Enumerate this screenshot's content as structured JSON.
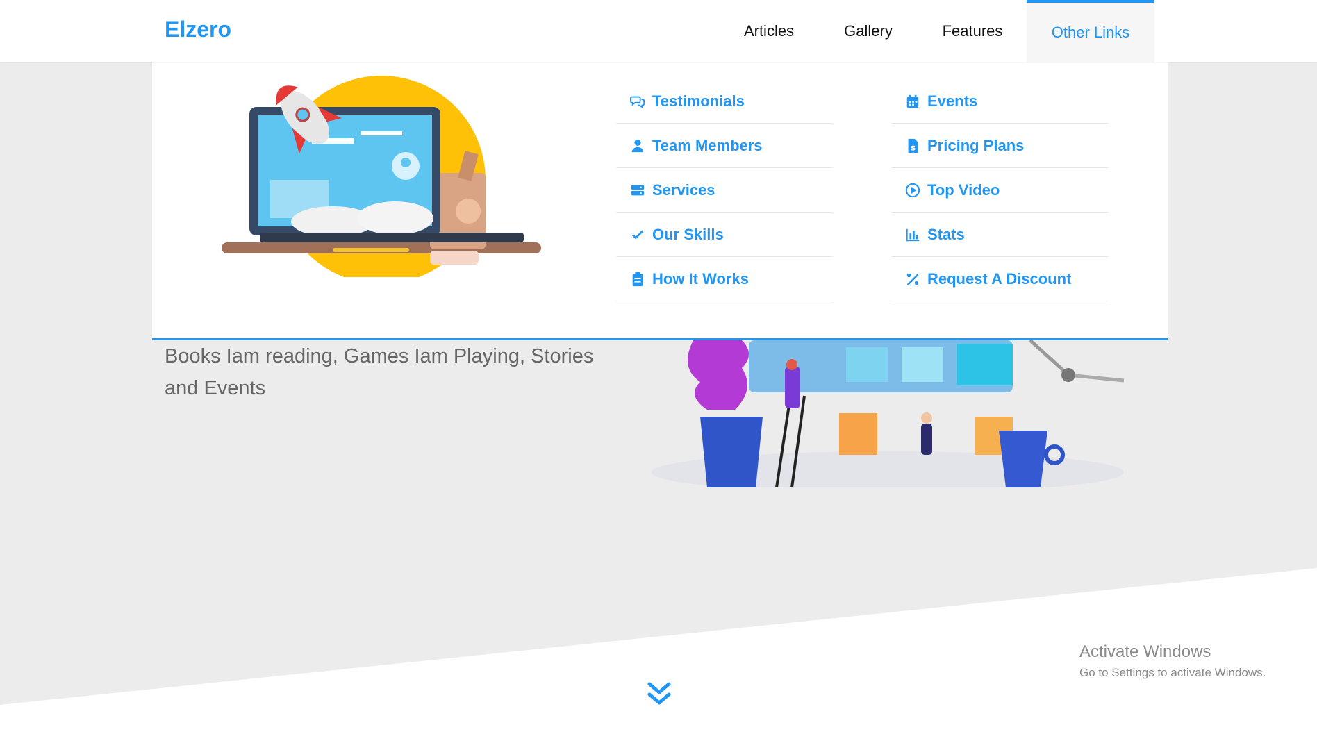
{
  "header": {
    "logo": "Elzero",
    "nav": [
      {
        "label": "Articles"
      },
      {
        "label": "Gallery"
      },
      {
        "label": "Features"
      },
      {
        "label": "Other Links"
      }
    ]
  },
  "mega_menu": {
    "col1": [
      {
        "label": "Testimonials",
        "icon": "comments-icon"
      },
      {
        "label": "Team Members",
        "icon": "user-icon"
      },
      {
        "label": "Services",
        "icon": "server-icon"
      },
      {
        "label": "Our Skills",
        "icon": "check-icon"
      },
      {
        "label": "How It Works",
        "icon": "clipboard-icon"
      }
    ],
    "col2": [
      {
        "label": "Events",
        "icon": "calendar-icon"
      },
      {
        "label": "Pricing Plans",
        "icon": "invoice-dollar-icon"
      },
      {
        "label": "Top Video",
        "icon": "play-circle-icon"
      },
      {
        "label": "Stats",
        "icon": "chart-bar-icon"
      },
      {
        "label": "Request A Discount",
        "icon": "percent-icon"
      }
    ]
  },
  "hero": {
    "text": "Books Iam reading, Games Iam Playing, Stories and Events"
  },
  "watermark": {
    "title": "Activate Windows",
    "subtitle": "Go to Settings to activate Windows."
  },
  "colors": {
    "accent": "#2196f3",
    "background": "#ececec"
  }
}
